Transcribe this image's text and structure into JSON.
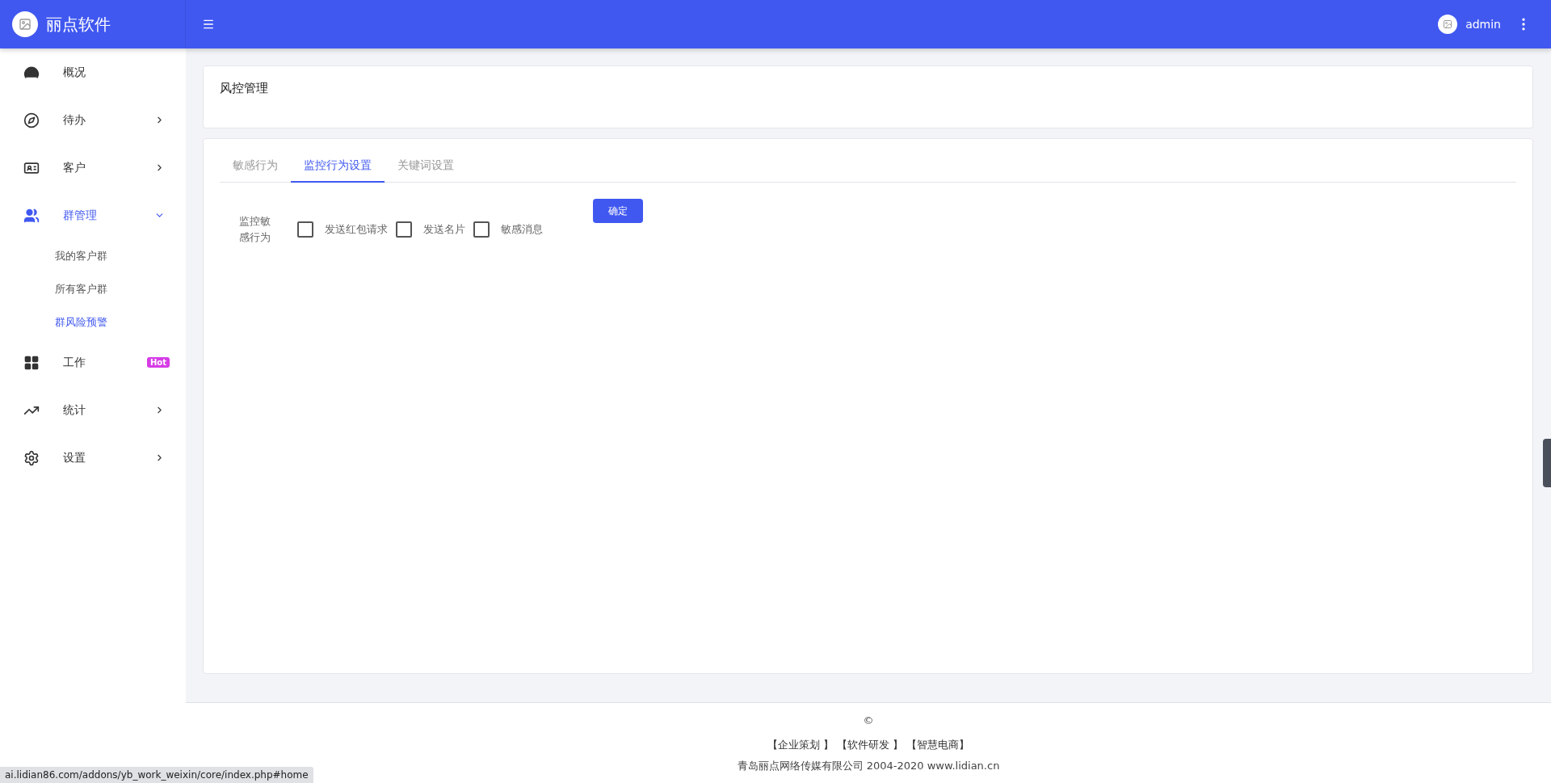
{
  "header": {
    "brand": "丽点软件",
    "user": "admin"
  },
  "sidebar": [
    {
      "label": "概况",
      "selected": false
    },
    {
      "label": "待办",
      "expanded": false,
      "selected": false
    },
    {
      "label": "客户",
      "expanded": false,
      "selected": false
    },
    {
      "label": "群管理",
      "expanded": true,
      "selected": true,
      "children": [
        {
          "label": "我的客户群",
          "selected": false
        },
        {
          "label": "所有客户群",
          "selected": false
        },
        {
          "label": "群风险预警",
          "selected": true
        }
      ]
    },
    {
      "label": "工作",
      "selected": false,
      "badge": "Hot"
    },
    {
      "label": "统计",
      "expanded": false,
      "selected": false
    },
    {
      "label": "设置",
      "expanded": false,
      "selected": false
    }
  ],
  "page_title": "风控管理",
  "tabs": [
    {
      "label": "敏感行为",
      "selected": false
    },
    {
      "label": "监控行为设置",
      "selected": true
    },
    {
      "label": "关键词设置",
      "selected": false
    }
  ],
  "form": {
    "label": "监控敏感行为",
    "options": [
      {
        "label": "发送红包请求",
        "checked": false
      },
      {
        "label": "发送名片",
        "checked": false
      },
      {
        "label": "敏感消息",
        "checked": false
      }
    ],
    "submit": "确定"
  },
  "footer": {
    "copyright_mark": "©",
    "links": [
      "【企业策划 】",
      "【软件研发 】",
      "【智慧电商】"
    ],
    "company": "青岛丽点网络传媒有限公司 2004-2020 www.lidian.cn"
  },
  "status_url": "ai.lidian86.com/addons/yb_work_weixin/core/index.php#home"
}
